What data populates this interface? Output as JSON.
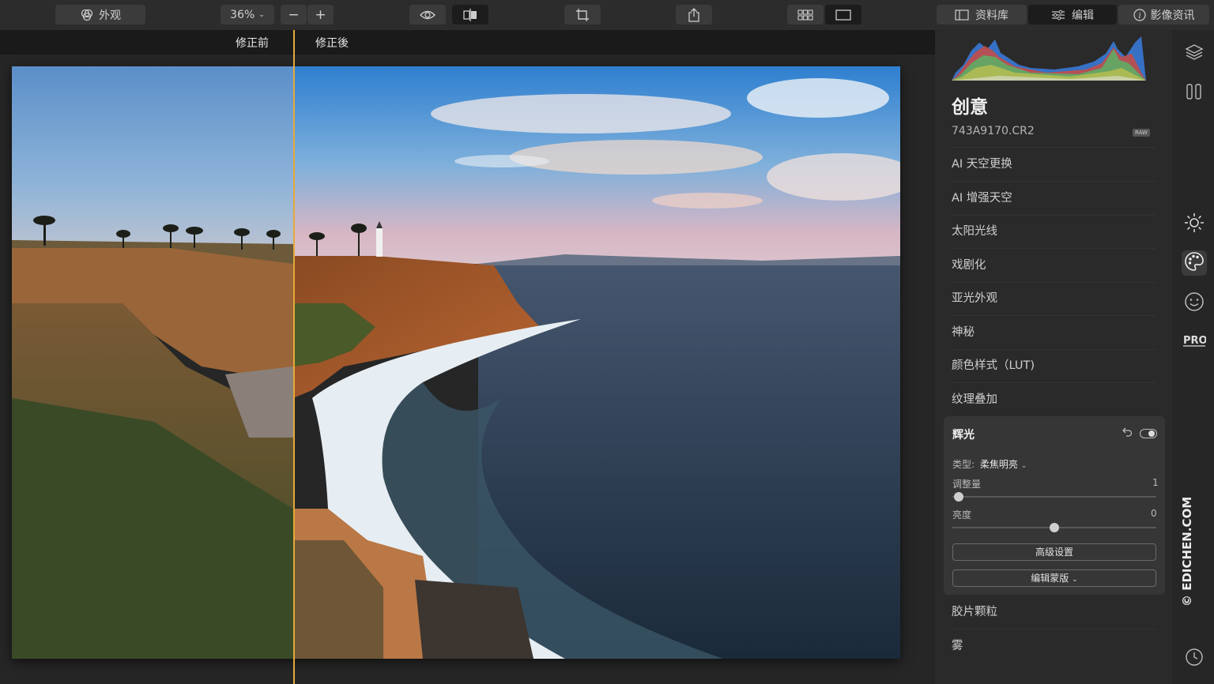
{
  "toolbar": {
    "appearance_label": "外观",
    "zoom_value": "36%",
    "zoom_out": "−",
    "zoom_in": "+",
    "tab_library": "资料库",
    "tab_edit": "编辑",
    "tab_info": "影像资讯"
  },
  "compare": {
    "before_label": "修正前",
    "after_label": "修正後"
  },
  "panel": {
    "title": "创意",
    "filename": "743A9170.CR2",
    "raw_badge": "RAW",
    "menu_items": [
      "AI 天空更换",
      "AI 增强天空",
      "太阳光线",
      "戏剧化",
      "亚光外观",
      "神秘",
      "颜色样式（LUT)",
      "纹理叠加"
    ],
    "glow": {
      "title": "辉光",
      "type_label": "类型:",
      "type_value": "柔焦明亮",
      "amount_label": "调整量",
      "amount_value": "1",
      "amount_level": 0.01,
      "brightness_label": "亮度",
      "brightness_value": "0",
      "brightness_level": 0.5,
      "advanced_button": "高级设置",
      "mask_button": "编辑蒙版"
    },
    "menu_items_after": [
      "胶片颗粒",
      "雾"
    ]
  },
  "watermark": "© EDICHEN.COM",
  "icons": [
    "appearance-icon",
    "eye-icon",
    "compare-icon",
    "crop-icon",
    "share-icon",
    "grid-view-icon",
    "single-view-icon",
    "library-icon",
    "edit-sliders-icon",
    "info-icon",
    "layers-icon",
    "presets-icon",
    "sun-icon",
    "palette-icon",
    "face-icon",
    "pro-icon",
    "history-icon",
    "undo-icon",
    "toggle-icon"
  ]
}
